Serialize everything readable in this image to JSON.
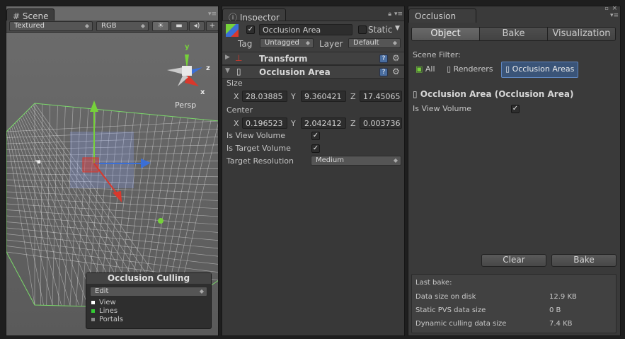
{
  "scene": {
    "tab_label": "Scene",
    "draw_mode": "Textured",
    "render_mode": "RGB",
    "persp_label": "Persp",
    "gizmo_axes": [
      "y",
      "z",
      "x"
    ],
    "culling": {
      "title": "Occlusion Culling",
      "mode": "Edit",
      "legend": [
        {
          "label": "View",
          "color": "#ffffff"
        },
        {
          "label": "Lines",
          "color": "#33cc33"
        },
        {
          "label": "Portals",
          "color": "#888888"
        }
      ]
    }
  },
  "inspector": {
    "tab_label": "Inspector",
    "object_name": "Occlusion Area",
    "static_label": "Static",
    "tag_label": "Tag",
    "tag_value": "Untagged",
    "layer_label": "Layer",
    "layer_value": "Default",
    "transform_label": "Transform",
    "component_label": "Occlusion Area",
    "size_label": "Size",
    "size": {
      "x": "28.03885",
      "y": "9.360421",
      "z": "17.45065"
    },
    "center_label": "Center",
    "center": {
      "x": "0.196523",
      "y": "2.042412",
      "z": "0.003736"
    },
    "axis_x": "X",
    "axis_y": "Y",
    "axis_z": "Z",
    "is_view_volume_label": "Is View Volume",
    "is_view_volume": true,
    "is_target_volume_label": "Is Target Volume",
    "is_target_volume": true,
    "target_resolution_label": "Target Resolution",
    "target_resolution_value": "Medium"
  },
  "occlusion": {
    "tab_label": "Occlusion",
    "tabs": [
      "Object",
      "Bake",
      "Visualization"
    ],
    "active_tab": "Object",
    "scene_filter_label": "Scene Filter:",
    "filters": [
      "All",
      "Renderers",
      "Occlusion Areas"
    ],
    "active_filter": "Occlusion Areas",
    "section_title": "Occlusion Area (Occlusion Area)",
    "is_view_volume_label": "Is View Volume",
    "clear_label": "Clear",
    "bake_label": "Bake",
    "stats": {
      "title": "Last bake:",
      "rows": [
        {
          "label": "Data size on disk",
          "value": "12.9 KB"
        },
        {
          "label": "Static PVS data size",
          "value": "0 B"
        },
        {
          "label": "Dynamic culling data size",
          "value": "7.4 KB"
        }
      ]
    }
  },
  "colors": {
    "accent": "#4d6f9e",
    "x_axis": "#d9382c",
    "y_axis": "#76d13a",
    "z_axis": "#3b6fd6",
    "active_filter_bg": "#3a5478"
  }
}
